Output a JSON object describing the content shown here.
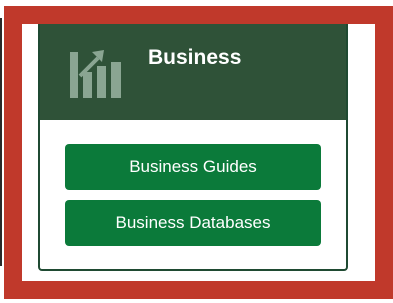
{
  "card": {
    "title": "Business",
    "icon": "bar-chart-growth-icon",
    "buttons": [
      {
        "label": "Business Guides"
      },
      {
        "label": "Business Databases"
      }
    ]
  },
  "colors": {
    "header_bg": "#2f5238",
    "button_bg": "#0b7a3a",
    "highlight_border": "#c0392b"
  }
}
